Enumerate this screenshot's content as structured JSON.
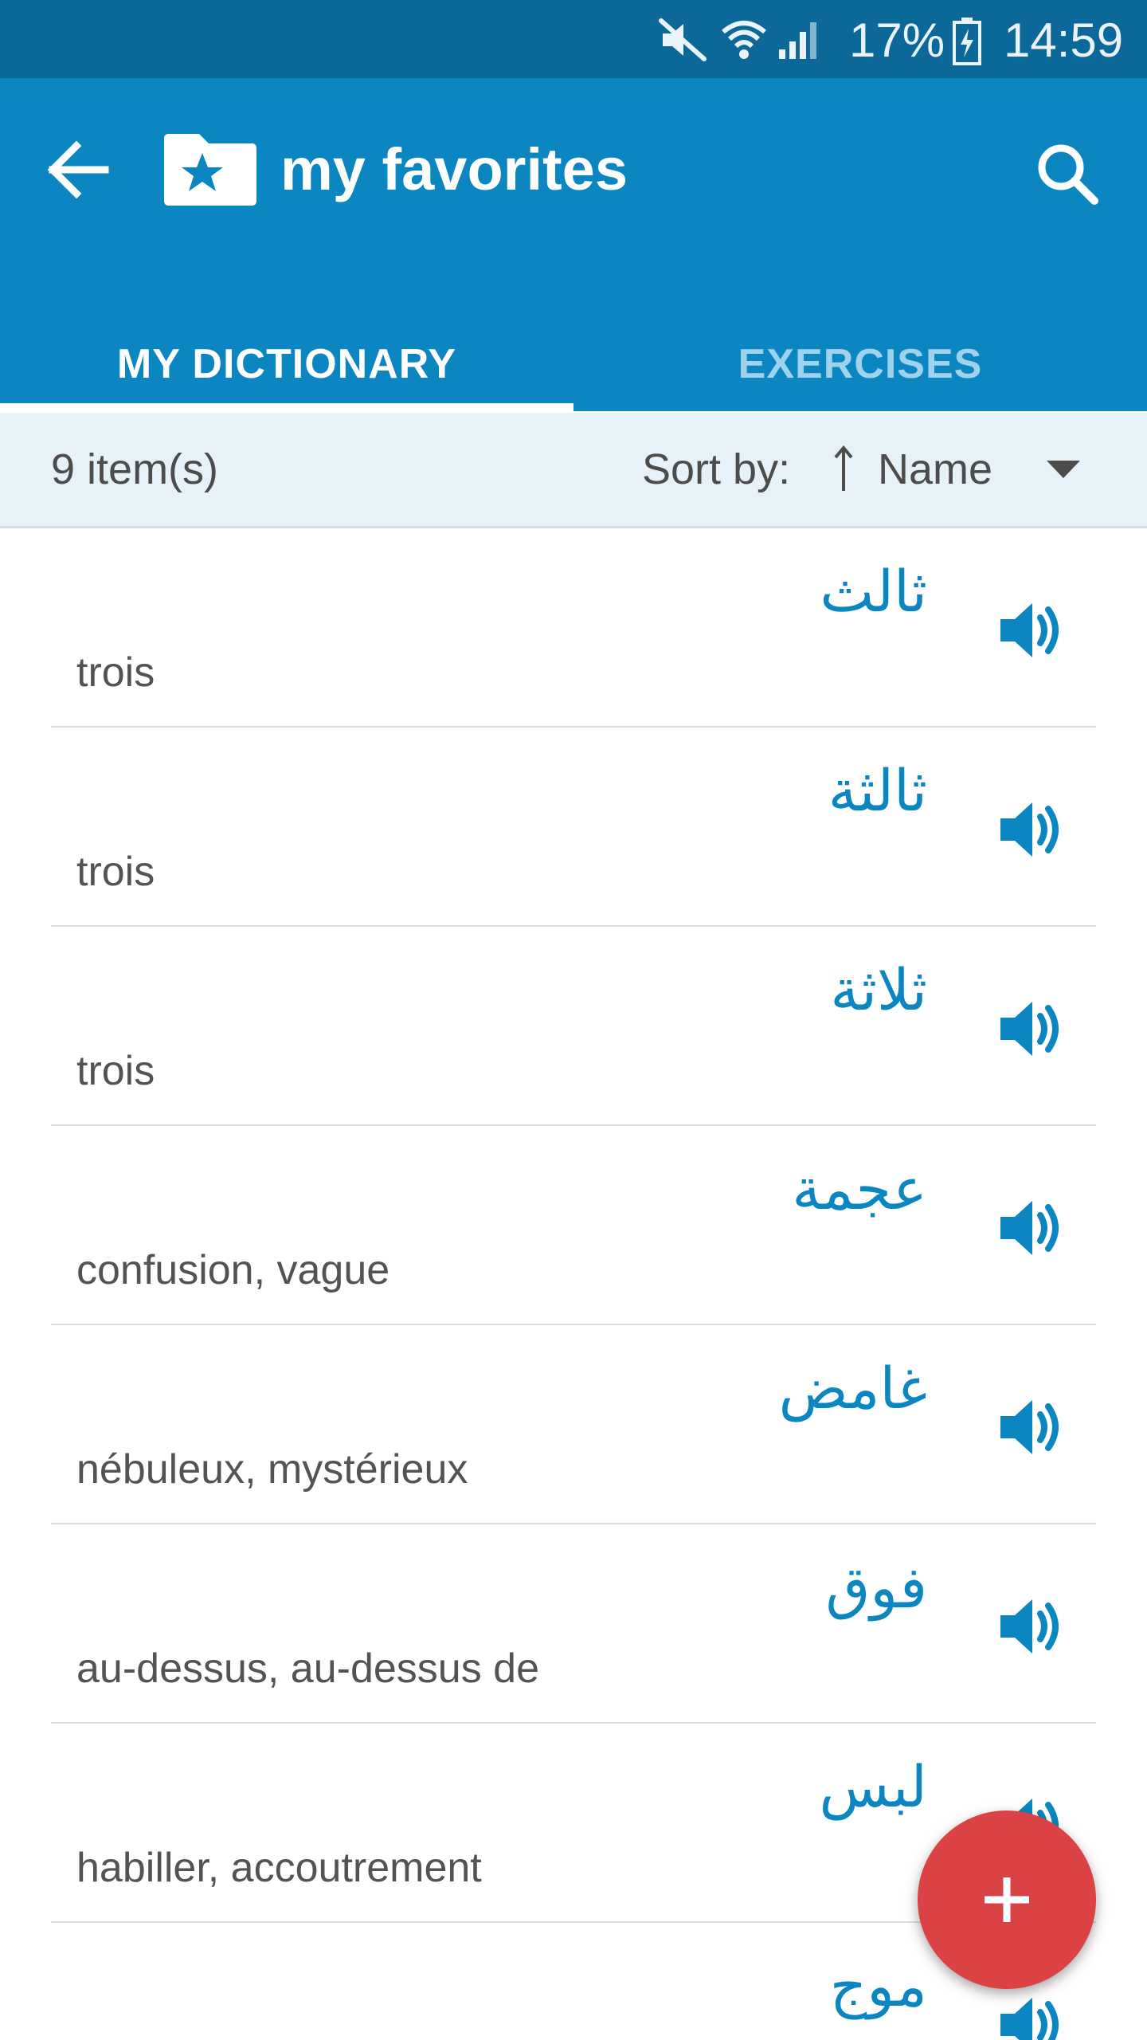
{
  "status_bar": {
    "icons": [
      "mute-icon",
      "wifi-icon",
      "signal-icon",
      "battery-charging-icon"
    ],
    "battery_percent": "17%",
    "time": "14:59"
  },
  "app_bar": {
    "back_icon": "arrow-left-icon",
    "folder_icon": "folder-star-icon",
    "title": "my favorites",
    "search_icon": "search-icon"
  },
  "tabs": [
    {
      "label": "MY DICTIONARY",
      "active": true
    },
    {
      "label": "EXERCISES",
      "active": false
    }
  ],
  "sort_bar": {
    "item_count": "9 item(s)",
    "sort_label": "Sort by:",
    "sort_value": "Name",
    "sort_direction_icon": "arrow-up-icon",
    "dropdown_icon": "triangle-down-icon"
  },
  "items": [
    {
      "word": "ثالث",
      "translation": "trois"
    },
    {
      "word": "ثالثة",
      "translation": "trois"
    },
    {
      "word": "ثلاثة",
      "translation": "trois"
    },
    {
      "word": "عجمة",
      "translation": "confusion, vague"
    },
    {
      "word": "غامض",
      "translation": "nébuleux, mystérieux"
    },
    {
      "word": "فوق",
      "translation": "au-dessus, au-dessus de"
    },
    {
      "word": "لبس",
      "translation": "habiller, accoutrement"
    },
    {
      "word": "موج",
      "translation": ""
    }
  ],
  "fab": {
    "icon": "plus-icon"
  },
  "colors": {
    "status_bar": "#0b6898",
    "primary": "#0c86c1",
    "sort_bar_bg": "#e6f2f8",
    "fab": "#db4244",
    "tab_inactive": "#9ed3ee"
  }
}
